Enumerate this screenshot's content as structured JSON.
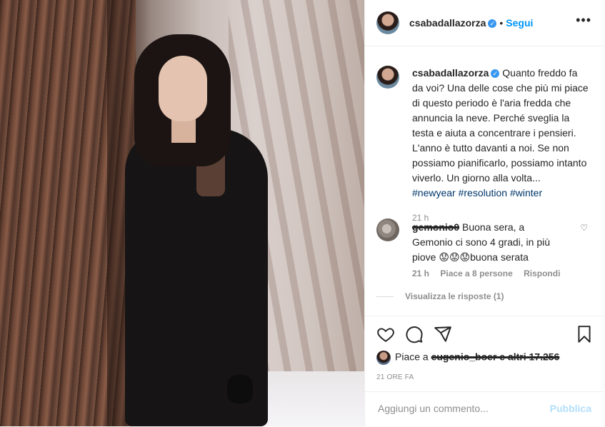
{
  "post": {
    "username": "csabadallazorza",
    "follow_label": "Segui",
    "more_label": "•••",
    "separator": "•"
  },
  "caption": {
    "username": "csabadallazorza",
    "text": "Quanto freddo fa da voi? Una delle cose che più mi piace di questo periodo è l'aria fredda che annuncia la neve. Perché sveglia la testa e aiuta a concentrare i pensieri. L'anno è tutto davanti a noi. Se non possiamo pianificarlo, possiamo intanto viverlo. Un giorno alla volta...",
    "hashtags": [
      "#newyear",
      "#resolution",
      "#winter"
    ],
    "time": "21 h"
  },
  "comment": {
    "username_scribbled": "gemonio0",
    "text": "Buona sera, a Gemonio ci sono 4 gradi, in più piove 😟😟😟buona serata",
    "time": "21 h",
    "likes": "Piace a 8 persone",
    "reply": "Rispondi",
    "view_replies": "Visualizza le risposte (1)"
  },
  "actions": {
    "likes_prefix": "Piace a",
    "likes_scribbled": "eugenio_boer e altri 17.256",
    "timestamp": "21 ORE FA"
  },
  "add_comment": {
    "placeholder": "Aggiungi un commento...",
    "publish": "Pubblica"
  },
  "colors": {
    "accent": "#0095f6",
    "link": "#00376b",
    "muted": "#8e8e8e",
    "publish_disabled": "#b2dffc"
  }
}
